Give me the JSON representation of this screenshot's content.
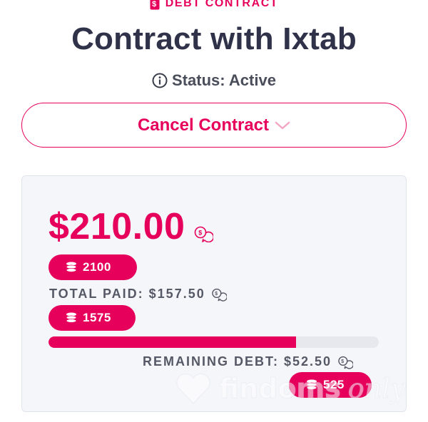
{
  "header": {
    "eyebrow": "DEBT CONTRACT",
    "eyebrow_icon": "document-dollar-icon",
    "title": "Contract with Ixtab"
  },
  "status": {
    "icon": "info-icon",
    "text": "Status: Active"
  },
  "actions": {
    "cancel_label": "Cancel Contract",
    "cancel_icon": "chevron-down-icon"
  },
  "summary": {
    "total_amount": "$210.00",
    "total_tokens": "2100",
    "total_paid_label": "TOTAL PAID: $157.50",
    "paid_tokens": "1575",
    "progress_fraction": 0.75,
    "remaining_label": "REMAINING DEBT: $52.50",
    "remaining_tokens": "525"
  },
  "watermark": {
    "text": "findoms",
    "script": "only"
  },
  "colors": {
    "accent": "#e6005c",
    "text_dark": "#2f3249",
    "card_bg": "#f4f6f9",
    "track": "#e6e8ee"
  }
}
